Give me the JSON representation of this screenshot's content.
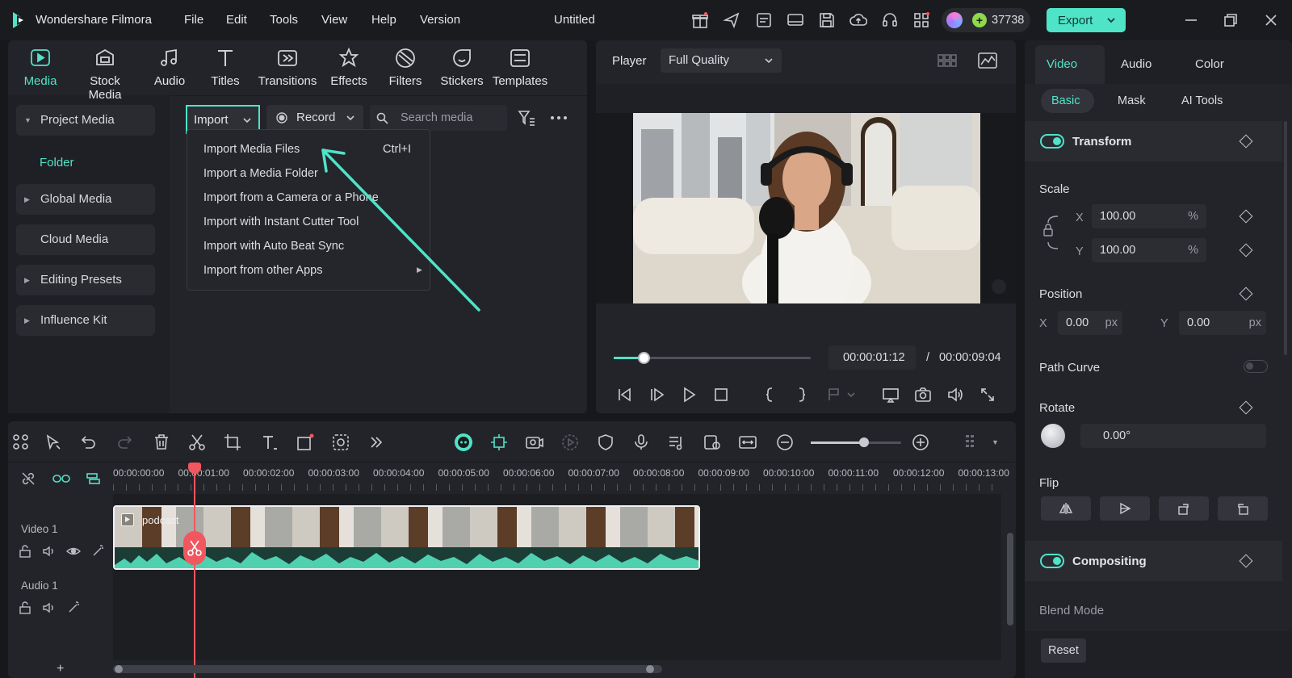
{
  "app": {
    "name": "Wondershare Filmora",
    "doc_title": "Untitled",
    "menus": [
      "File",
      "Edit",
      "Tools",
      "View",
      "Help",
      "Version"
    ],
    "credits": "37738",
    "export_label": "Export"
  },
  "toolbar": {
    "tools": [
      "Media",
      "Stock Media",
      "Audio",
      "Titles",
      "Transitions",
      "Effects",
      "Filters",
      "Stickers",
      "Templates"
    ]
  },
  "sidebar": {
    "items": [
      "Project Media",
      "Folder",
      "Global Media",
      "Cloud Media",
      "Editing Presets",
      "Influence Kit"
    ]
  },
  "media": {
    "import_label": "Import",
    "record_label": "Record",
    "search_placeholder": "Search media"
  },
  "import_menu": {
    "items": [
      {
        "label": "Import Media Files",
        "shortcut": "Ctrl+I"
      },
      {
        "label": "Import a Media Folder",
        "shortcut": ""
      },
      {
        "label": "Import from a Camera or a Phone",
        "shortcut": ""
      },
      {
        "label": "Import with Instant Cutter Tool",
        "shortcut": ""
      },
      {
        "label": "Import with Auto Beat Sync",
        "shortcut": ""
      },
      {
        "label": "Import from other Apps",
        "shortcut": ""
      }
    ]
  },
  "player": {
    "label": "Player",
    "quality": "Full Quality",
    "current_time": "00:00:01:12",
    "separator": "/",
    "total_time": "00:00:09:04",
    "progress": 0.16
  },
  "inspector": {
    "tabs": [
      "Video",
      "Audio",
      "Color"
    ],
    "subtabs": [
      "Basic",
      "Mask",
      "AI Tools"
    ],
    "transform_label": "Transform",
    "scale_label": "Scale",
    "scale_x": "100.00",
    "scale_y": "100.00",
    "percent": "%",
    "x_label": "X",
    "y_label": "Y",
    "position_label": "Position",
    "pos_x": "0.00",
    "pos_y": "0.00",
    "px": "px",
    "path_curve_label": "Path Curve",
    "rotate_label": "Rotate",
    "rotate_value": "0.00°",
    "flip_label": "Flip",
    "compositing_label": "Compositing",
    "blend_mode_label": "Blend Mode",
    "reset_label": "Reset"
  },
  "timeline": {
    "ruler": [
      "00:00:00:00",
      "00:00:01:00",
      "00:00:02:00",
      "00:00:03:00",
      "00:00:04:00",
      "00:00:05:00",
      "00:00:06:00",
      "00:00:07:00",
      "00:00:08:00",
      "00:00:09:00",
      "00:00:10:00",
      "00:00:11:00",
      "00:00:12:00",
      "00:00:13:00"
    ],
    "video_track": "Video 1",
    "audio_track": "Audio 1",
    "clip_name": "podcast",
    "add_track": "+",
    "zoom_level": 0.6
  },
  "colors": {
    "accent": "#4fe3c8",
    "playhead": "#f0575f",
    "bg": "#17181b",
    "panel": "#232429"
  }
}
